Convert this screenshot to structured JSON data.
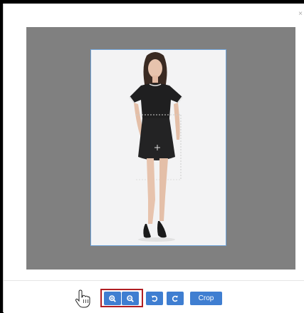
{
  "dialog": {
    "close_glyph": "×"
  },
  "editor": {
    "image_subject": "model-in-black-dress"
  },
  "toolbar": {
    "zoom_in_icon": "zoom-in-icon",
    "zoom_out_icon": "zoom-out-icon",
    "rotate_left_icon": "rotate-left-icon",
    "rotate_right_icon": "rotate-right-icon",
    "crop_label": "Crop",
    "accent_color": "#3f7ed1",
    "highlight_color": "#b01e23"
  }
}
